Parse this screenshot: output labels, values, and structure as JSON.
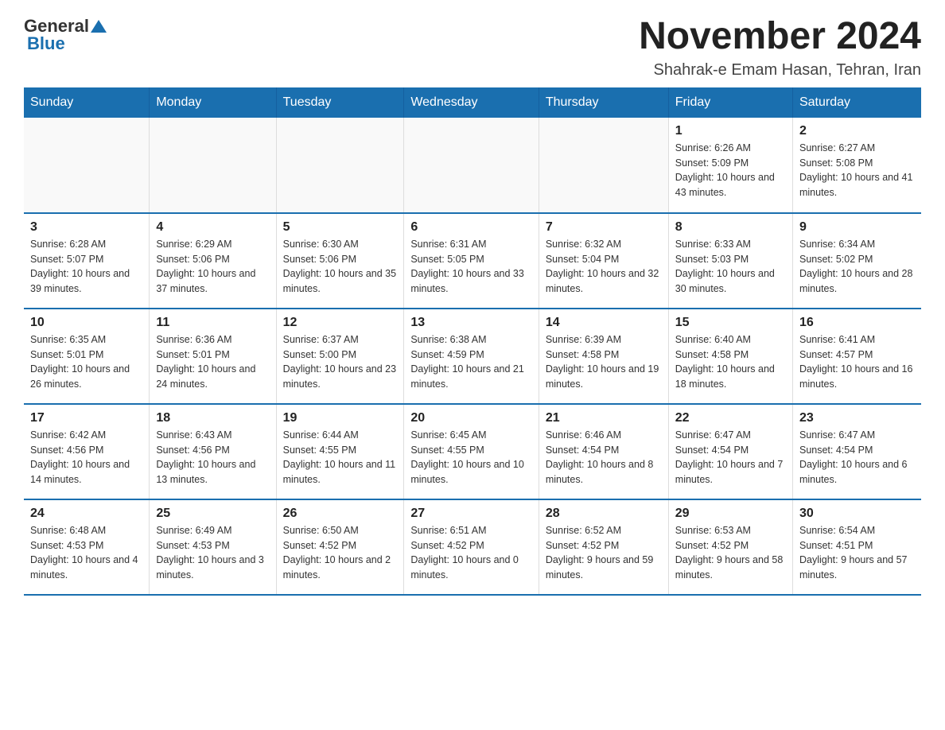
{
  "logo": {
    "general": "General",
    "blue": "Blue"
  },
  "header": {
    "month": "November 2024",
    "location": "Shahrak-e Emam Hasan, Tehran, Iran"
  },
  "days_of_week": [
    "Sunday",
    "Monday",
    "Tuesday",
    "Wednesday",
    "Thursday",
    "Friday",
    "Saturday"
  ],
  "weeks": [
    [
      {
        "day": "",
        "info": ""
      },
      {
        "day": "",
        "info": ""
      },
      {
        "day": "",
        "info": ""
      },
      {
        "day": "",
        "info": ""
      },
      {
        "day": "",
        "info": ""
      },
      {
        "day": "1",
        "info": "Sunrise: 6:26 AM\nSunset: 5:09 PM\nDaylight: 10 hours and 43 minutes."
      },
      {
        "day": "2",
        "info": "Sunrise: 6:27 AM\nSunset: 5:08 PM\nDaylight: 10 hours and 41 minutes."
      }
    ],
    [
      {
        "day": "3",
        "info": "Sunrise: 6:28 AM\nSunset: 5:07 PM\nDaylight: 10 hours and 39 minutes."
      },
      {
        "day": "4",
        "info": "Sunrise: 6:29 AM\nSunset: 5:06 PM\nDaylight: 10 hours and 37 minutes."
      },
      {
        "day": "5",
        "info": "Sunrise: 6:30 AM\nSunset: 5:06 PM\nDaylight: 10 hours and 35 minutes."
      },
      {
        "day": "6",
        "info": "Sunrise: 6:31 AM\nSunset: 5:05 PM\nDaylight: 10 hours and 33 minutes."
      },
      {
        "day": "7",
        "info": "Sunrise: 6:32 AM\nSunset: 5:04 PM\nDaylight: 10 hours and 32 minutes."
      },
      {
        "day": "8",
        "info": "Sunrise: 6:33 AM\nSunset: 5:03 PM\nDaylight: 10 hours and 30 minutes."
      },
      {
        "day": "9",
        "info": "Sunrise: 6:34 AM\nSunset: 5:02 PM\nDaylight: 10 hours and 28 minutes."
      }
    ],
    [
      {
        "day": "10",
        "info": "Sunrise: 6:35 AM\nSunset: 5:01 PM\nDaylight: 10 hours and 26 minutes."
      },
      {
        "day": "11",
        "info": "Sunrise: 6:36 AM\nSunset: 5:01 PM\nDaylight: 10 hours and 24 minutes."
      },
      {
        "day": "12",
        "info": "Sunrise: 6:37 AM\nSunset: 5:00 PM\nDaylight: 10 hours and 23 minutes."
      },
      {
        "day": "13",
        "info": "Sunrise: 6:38 AM\nSunset: 4:59 PM\nDaylight: 10 hours and 21 minutes."
      },
      {
        "day": "14",
        "info": "Sunrise: 6:39 AM\nSunset: 4:58 PM\nDaylight: 10 hours and 19 minutes."
      },
      {
        "day": "15",
        "info": "Sunrise: 6:40 AM\nSunset: 4:58 PM\nDaylight: 10 hours and 18 minutes."
      },
      {
        "day": "16",
        "info": "Sunrise: 6:41 AM\nSunset: 4:57 PM\nDaylight: 10 hours and 16 minutes."
      }
    ],
    [
      {
        "day": "17",
        "info": "Sunrise: 6:42 AM\nSunset: 4:56 PM\nDaylight: 10 hours and 14 minutes."
      },
      {
        "day": "18",
        "info": "Sunrise: 6:43 AM\nSunset: 4:56 PM\nDaylight: 10 hours and 13 minutes."
      },
      {
        "day": "19",
        "info": "Sunrise: 6:44 AM\nSunset: 4:55 PM\nDaylight: 10 hours and 11 minutes."
      },
      {
        "day": "20",
        "info": "Sunrise: 6:45 AM\nSunset: 4:55 PM\nDaylight: 10 hours and 10 minutes."
      },
      {
        "day": "21",
        "info": "Sunrise: 6:46 AM\nSunset: 4:54 PM\nDaylight: 10 hours and 8 minutes."
      },
      {
        "day": "22",
        "info": "Sunrise: 6:47 AM\nSunset: 4:54 PM\nDaylight: 10 hours and 7 minutes."
      },
      {
        "day": "23",
        "info": "Sunrise: 6:47 AM\nSunset: 4:54 PM\nDaylight: 10 hours and 6 minutes."
      }
    ],
    [
      {
        "day": "24",
        "info": "Sunrise: 6:48 AM\nSunset: 4:53 PM\nDaylight: 10 hours and 4 minutes."
      },
      {
        "day": "25",
        "info": "Sunrise: 6:49 AM\nSunset: 4:53 PM\nDaylight: 10 hours and 3 minutes."
      },
      {
        "day": "26",
        "info": "Sunrise: 6:50 AM\nSunset: 4:52 PM\nDaylight: 10 hours and 2 minutes."
      },
      {
        "day": "27",
        "info": "Sunrise: 6:51 AM\nSunset: 4:52 PM\nDaylight: 10 hours and 0 minutes."
      },
      {
        "day": "28",
        "info": "Sunrise: 6:52 AM\nSunset: 4:52 PM\nDaylight: 9 hours and 59 minutes."
      },
      {
        "day": "29",
        "info": "Sunrise: 6:53 AM\nSunset: 4:52 PM\nDaylight: 9 hours and 58 minutes."
      },
      {
        "day": "30",
        "info": "Sunrise: 6:54 AM\nSunset: 4:51 PM\nDaylight: 9 hours and 57 minutes."
      }
    ]
  ]
}
